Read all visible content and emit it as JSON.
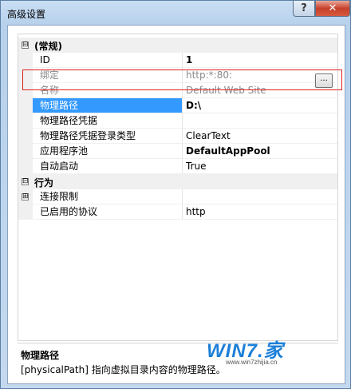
{
  "window": {
    "title": "高级设置"
  },
  "titlebar": {
    "help_label": "?",
    "close_label": "✕"
  },
  "grid": {
    "categories": {
      "general": {
        "label": "(常规)",
        "expander": "⊟"
      },
      "behavior": {
        "label": "行为",
        "expander": "⊟"
      }
    },
    "rows": {
      "id": {
        "name": "ID",
        "value": "1"
      },
      "binding": {
        "name": "绑定",
        "value": "http:*:80:"
      },
      "site_name": {
        "name": "名称",
        "value": "Default Web Site"
      },
      "physical_path": {
        "name": "物理路径",
        "value": "D:\\"
      },
      "physical_path_credentials": {
        "name": "物理路径凭据",
        "value": ""
      },
      "logon_type": {
        "name": "物理路径凭据登录类型",
        "value": "ClearText"
      },
      "app_pool": {
        "name": "应用程序池",
        "value": "DefaultAppPool"
      },
      "auto_start": {
        "name": "自动启动",
        "value": "True"
      },
      "connection_limits": {
        "name": "连接限制",
        "value": "",
        "expander": "⊞"
      },
      "enabled_protocols": {
        "name": "已启用的协议",
        "value": "http"
      }
    },
    "ellipsis_label": "..."
  },
  "description": {
    "title": "物理路径",
    "text": "[physicalPath] 指向虚拟目录内容的物理路径。"
  },
  "watermark": {
    "main": "WIN7.家",
    "url": "www.win7zhijia.cn"
  }
}
